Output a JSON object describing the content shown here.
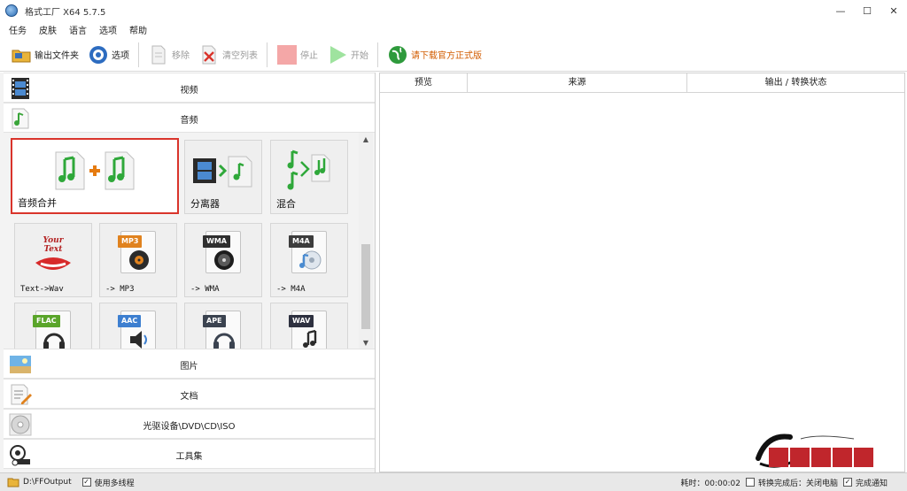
{
  "window": {
    "title": "格式工厂 X64 5.7.5",
    "minimize": "—",
    "maximize": "☐",
    "close": "✕"
  },
  "menu": [
    "任务",
    "皮肤",
    "语言",
    "选项",
    "帮助"
  ],
  "toolbar": {
    "output_folder": "输出文件夹",
    "options": "选项",
    "remove": "移除",
    "clear_list": "清空列表",
    "stop": "停止",
    "start": "开始",
    "download_official": "请下载官方正式版"
  },
  "categories": {
    "video": "视频",
    "audio": "音频",
    "picture": "图片",
    "document": "文档",
    "optical": "光驱设备\\DVD\\CD\\ISO",
    "toolbox": "工具集"
  },
  "audio_tiles": {
    "joiner": "音频合并",
    "splitter": "分离器",
    "mix": "混合",
    "text_wav": "Text->Wav",
    "to_mp3": "-> MP3",
    "to_wma": "-> WMA",
    "to_m4a": "-> M4A",
    "your_text": "Your Text",
    "badges": [
      "MP3",
      "WMA",
      "M4A",
      "FLAC",
      "AAC",
      "APE",
      "WAV"
    ]
  },
  "table": {
    "columns": [
      "预览",
      "来源",
      "输出 / 转换状态"
    ]
  },
  "status": {
    "output_path": "D:\\FFOutput",
    "multithread_label": "使用多线程",
    "elapsed_label": "耗时：00:00:02",
    "shutdown_label": "转换完成后：关闭电脑",
    "notify_label": "完成通知",
    "check": "✓"
  },
  "colors": {
    "accent_red": "#d9342b",
    "download_orange": "#d25c00",
    "panel_bg": "#f3f3f3",
    "badge_mp3": "#e0821e",
    "badge_wma": "#2f2f2f",
    "badge_m4a": "#3c3c3c",
    "badge_flac": "#5aa52a",
    "badge_aac": "#3d7fd0",
    "badge_ape": "#3b4350",
    "badge_wav": "#2e3140"
  },
  "watermark": "软件藏经阁"
}
